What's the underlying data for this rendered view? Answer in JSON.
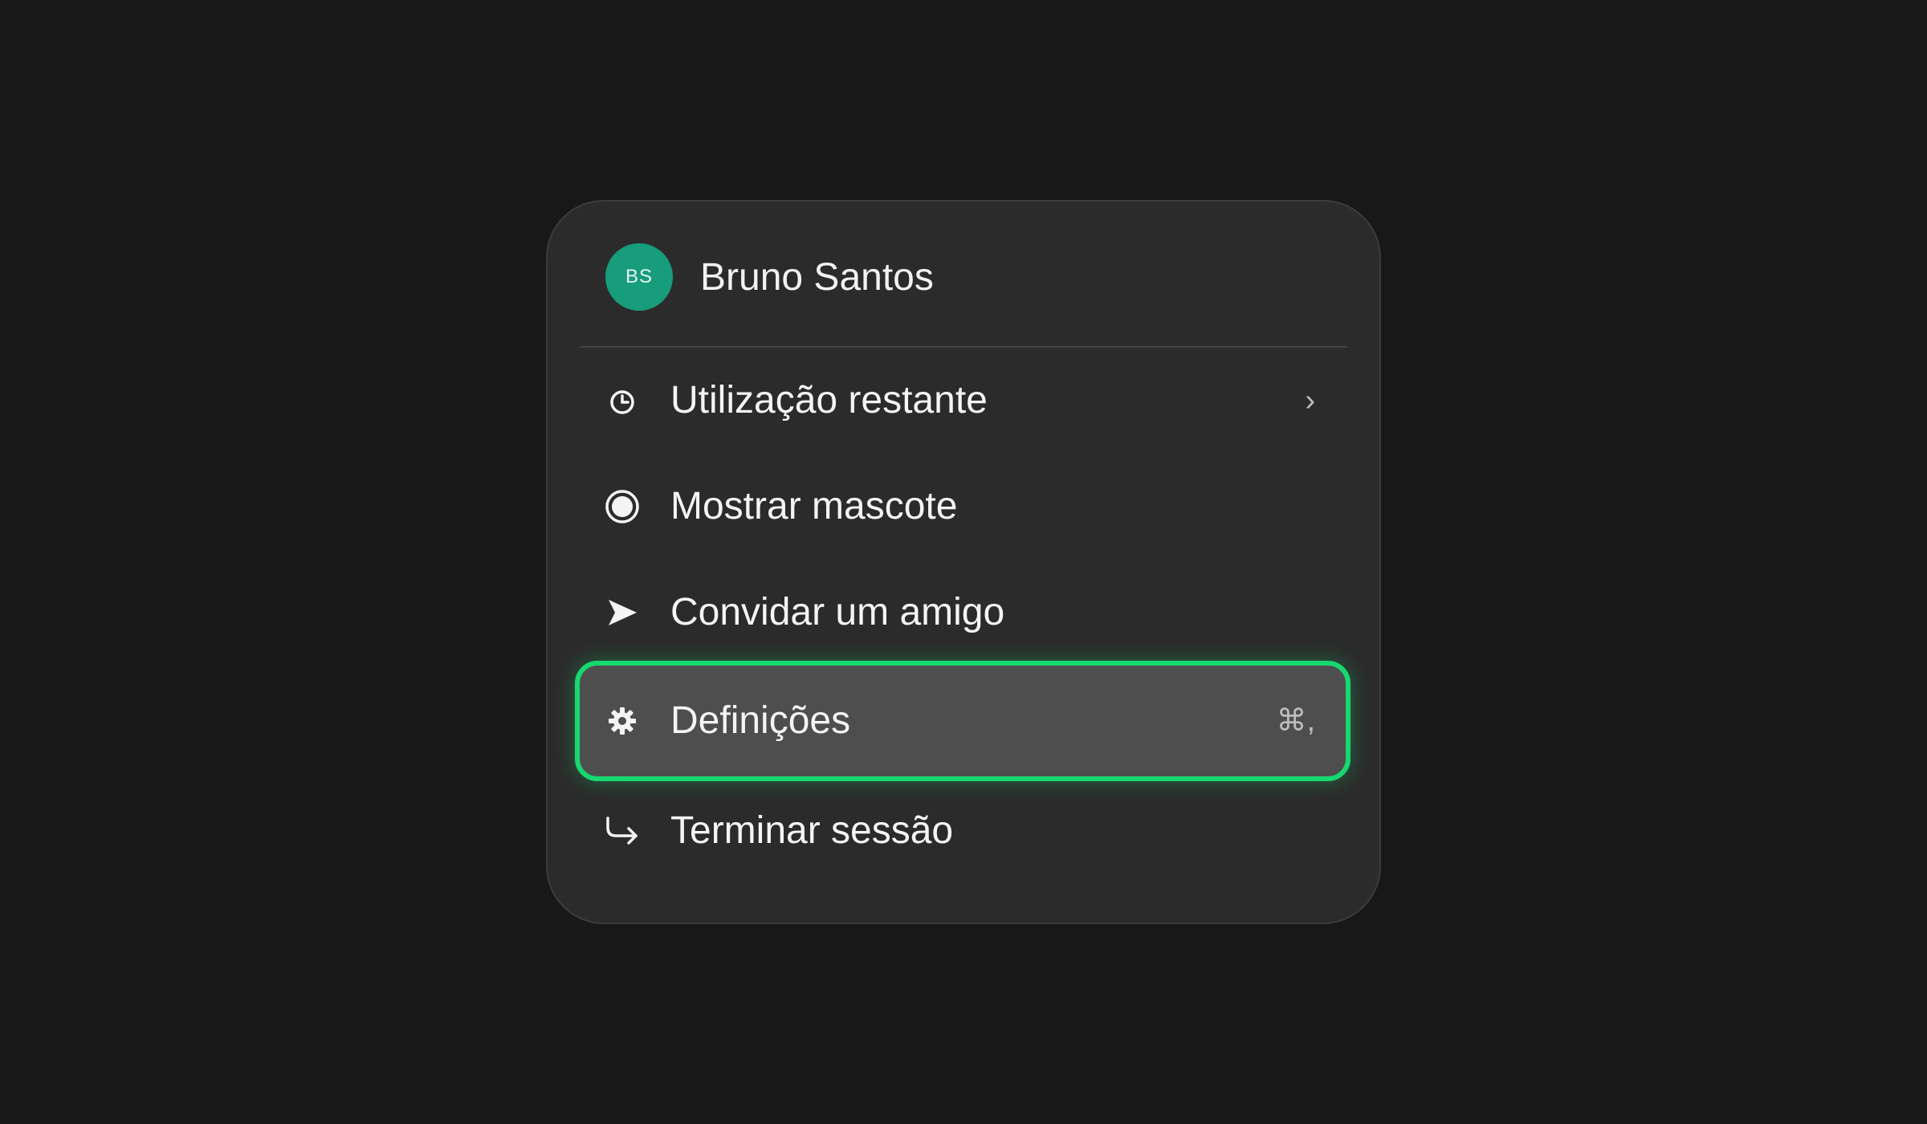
{
  "user": {
    "initials": "BS",
    "name": "Bruno Santos",
    "avatar_color": "#179c7c"
  },
  "menu": {
    "items": [
      {
        "label": "Utilização restante",
        "icon": "clock-icon",
        "trail": "›",
        "trail_icon": "chevron-right-icon"
      },
      {
        "label": "Mostrar mascote",
        "icon": "radio-filled-icon"
      },
      {
        "label": "Convidar um amigo",
        "icon": "send-arrow-icon"
      },
      {
        "label": "Definições",
        "icon": "gear-icon",
        "shortcut": "⌘,",
        "highlighted": true
      },
      {
        "label": "Terminar sessão",
        "icon": "logout-arrow-icon"
      }
    ],
    "highlight_color": "#17d86f"
  }
}
